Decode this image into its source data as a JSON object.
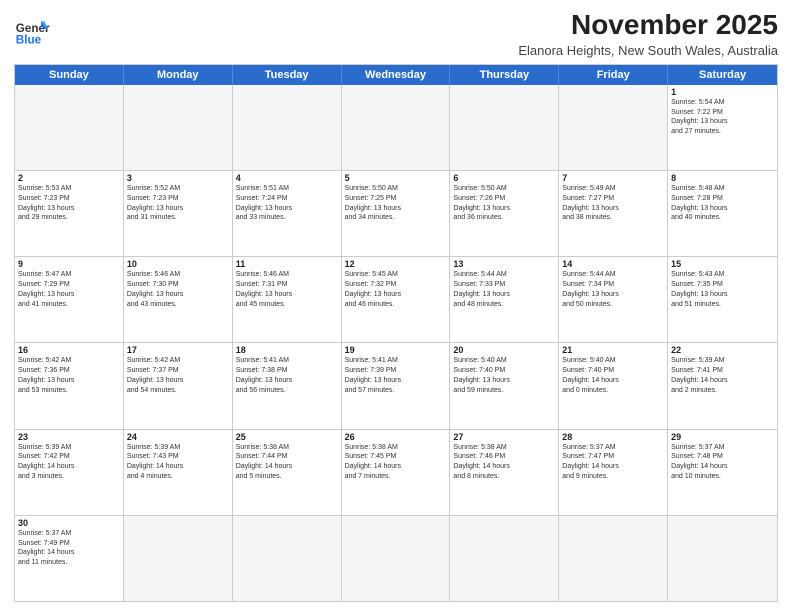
{
  "header": {
    "logo_general": "General",
    "logo_blue": "Blue",
    "month_title": "November 2025",
    "subtitle": "Elanora Heights, New South Wales, Australia"
  },
  "days_of_week": [
    "Sunday",
    "Monday",
    "Tuesday",
    "Wednesday",
    "Thursday",
    "Friday",
    "Saturday"
  ],
  "weeks": [
    [
      {
        "day": "",
        "text": ""
      },
      {
        "day": "",
        "text": ""
      },
      {
        "day": "",
        "text": ""
      },
      {
        "day": "",
        "text": ""
      },
      {
        "day": "",
        "text": ""
      },
      {
        "day": "",
        "text": ""
      },
      {
        "day": "1",
        "text": "Sunrise: 5:54 AM\nSunset: 7:22 PM\nDaylight: 13 hours\nand 27 minutes."
      }
    ],
    [
      {
        "day": "2",
        "text": "Sunrise: 5:53 AM\nSunset: 7:23 PM\nDaylight: 13 hours\nand 29 minutes."
      },
      {
        "day": "3",
        "text": "Sunrise: 5:52 AM\nSunset: 7:23 PM\nDaylight: 13 hours\nand 31 minutes."
      },
      {
        "day": "4",
        "text": "Sunrise: 5:51 AM\nSunset: 7:24 PM\nDaylight: 13 hours\nand 33 minutes."
      },
      {
        "day": "5",
        "text": "Sunrise: 5:50 AM\nSunset: 7:25 PM\nDaylight: 13 hours\nand 34 minutes."
      },
      {
        "day": "6",
        "text": "Sunrise: 5:50 AM\nSunset: 7:26 PM\nDaylight: 13 hours\nand 36 minutes."
      },
      {
        "day": "7",
        "text": "Sunrise: 5:49 AM\nSunset: 7:27 PM\nDaylight: 13 hours\nand 38 minutes."
      },
      {
        "day": "8",
        "text": "Sunrise: 5:48 AM\nSunset: 7:28 PM\nDaylight: 13 hours\nand 40 minutes."
      }
    ],
    [
      {
        "day": "9",
        "text": "Sunrise: 5:47 AM\nSunset: 7:29 PM\nDaylight: 13 hours\nand 41 minutes."
      },
      {
        "day": "10",
        "text": "Sunrise: 5:46 AM\nSunset: 7:30 PM\nDaylight: 13 hours\nand 43 minutes."
      },
      {
        "day": "11",
        "text": "Sunrise: 5:46 AM\nSunset: 7:31 PM\nDaylight: 13 hours\nand 45 minutes."
      },
      {
        "day": "12",
        "text": "Sunrise: 5:45 AM\nSunset: 7:32 PM\nDaylight: 13 hours\nand 46 minutes."
      },
      {
        "day": "13",
        "text": "Sunrise: 5:44 AM\nSunset: 7:33 PM\nDaylight: 13 hours\nand 48 minutes."
      },
      {
        "day": "14",
        "text": "Sunrise: 5:44 AM\nSunset: 7:34 PM\nDaylight: 13 hours\nand 50 minutes."
      },
      {
        "day": "15",
        "text": "Sunrise: 5:43 AM\nSunset: 7:35 PM\nDaylight: 13 hours\nand 51 minutes."
      }
    ],
    [
      {
        "day": "16",
        "text": "Sunrise: 5:42 AM\nSunset: 7:36 PM\nDaylight: 13 hours\nand 53 minutes."
      },
      {
        "day": "17",
        "text": "Sunrise: 5:42 AM\nSunset: 7:37 PM\nDaylight: 13 hours\nand 54 minutes."
      },
      {
        "day": "18",
        "text": "Sunrise: 5:41 AM\nSunset: 7:38 PM\nDaylight: 13 hours\nand 56 minutes."
      },
      {
        "day": "19",
        "text": "Sunrise: 5:41 AM\nSunset: 7:39 PM\nDaylight: 13 hours\nand 57 minutes."
      },
      {
        "day": "20",
        "text": "Sunrise: 5:40 AM\nSunset: 7:40 PM\nDaylight: 13 hours\nand 59 minutes."
      },
      {
        "day": "21",
        "text": "Sunrise: 5:40 AM\nSunset: 7:40 PM\nDaylight: 14 hours\nand 0 minutes."
      },
      {
        "day": "22",
        "text": "Sunrise: 5:39 AM\nSunset: 7:41 PM\nDaylight: 14 hours\nand 2 minutes."
      }
    ],
    [
      {
        "day": "23",
        "text": "Sunrise: 5:39 AM\nSunset: 7:42 PM\nDaylight: 14 hours\nand 3 minutes."
      },
      {
        "day": "24",
        "text": "Sunrise: 5:39 AM\nSunset: 7:43 PM\nDaylight: 14 hours\nand 4 minutes."
      },
      {
        "day": "25",
        "text": "Sunrise: 5:38 AM\nSunset: 7:44 PM\nDaylight: 14 hours\nand 5 minutes."
      },
      {
        "day": "26",
        "text": "Sunrise: 5:38 AM\nSunset: 7:45 PM\nDaylight: 14 hours\nand 7 minutes."
      },
      {
        "day": "27",
        "text": "Sunrise: 5:38 AM\nSunset: 7:46 PM\nDaylight: 14 hours\nand 8 minutes."
      },
      {
        "day": "28",
        "text": "Sunrise: 5:37 AM\nSunset: 7:47 PM\nDaylight: 14 hours\nand 9 minutes."
      },
      {
        "day": "29",
        "text": "Sunrise: 5:37 AM\nSunset: 7:48 PM\nDaylight: 14 hours\nand 10 minutes."
      }
    ],
    [
      {
        "day": "30",
        "text": "Sunrise: 5:37 AM\nSunset: 7:49 PM\nDaylight: 14 hours\nand 11 minutes."
      },
      {
        "day": "",
        "text": ""
      },
      {
        "day": "",
        "text": ""
      },
      {
        "day": "",
        "text": ""
      },
      {
        "day": "",
        "text": ""
      },
      {
        "day": "",
        "text": ""
      },
      {
        "day": "",
        "text": ""
      }
    ]
  ]
}
